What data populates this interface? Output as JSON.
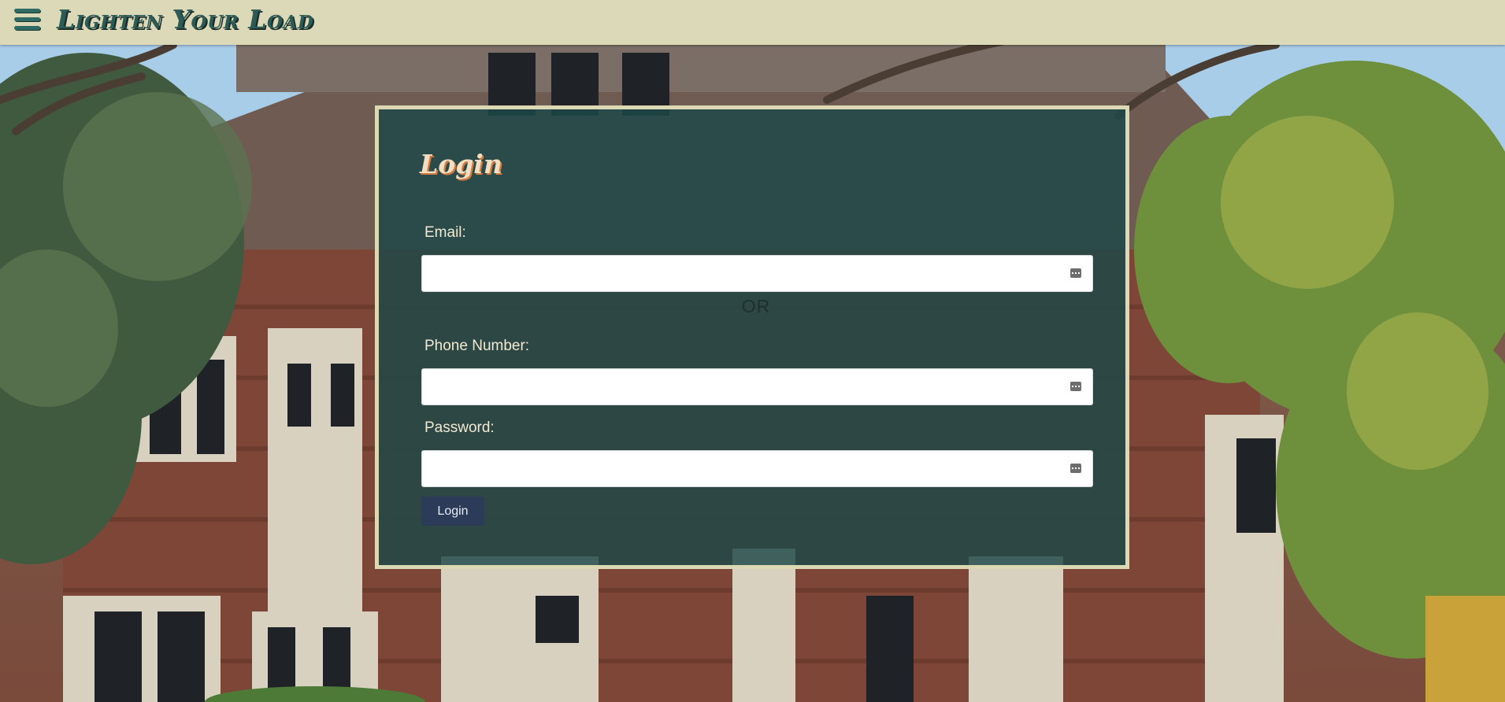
{
  "header": {
    "menu_icon": "hamburger-menu-icon",
    "brand": "Lighten Your Load",
    "bar_color": "#dcd9b8",
    "brand_color": "#2c5b55"
  },
  "login_form": {
    "title": "Login",
    "email": {
      "label": "Email:",
      "value": "",
      "placeholder": "",
      "icon": "autofill-icon"
    },
    "separator": "OR",
    "phone": {
      "label": "Phone Number:",
      "value": "",
      "placeholder": "",
      "icon": "autofill-icon"
    },
    "password": {
      "label": "Password:",
      "value": "",
      "placeholder": "",
      "icon": "autofill-icon"
    },
    "submit_label": "Login",
    "panel_color": "#1c4848",
    "panel_border_color": "#ddd8b4",
    "button_color": "#2b3b58"
  },
  "background": {
    "subject": "brick mansion with trees"
  }
}
